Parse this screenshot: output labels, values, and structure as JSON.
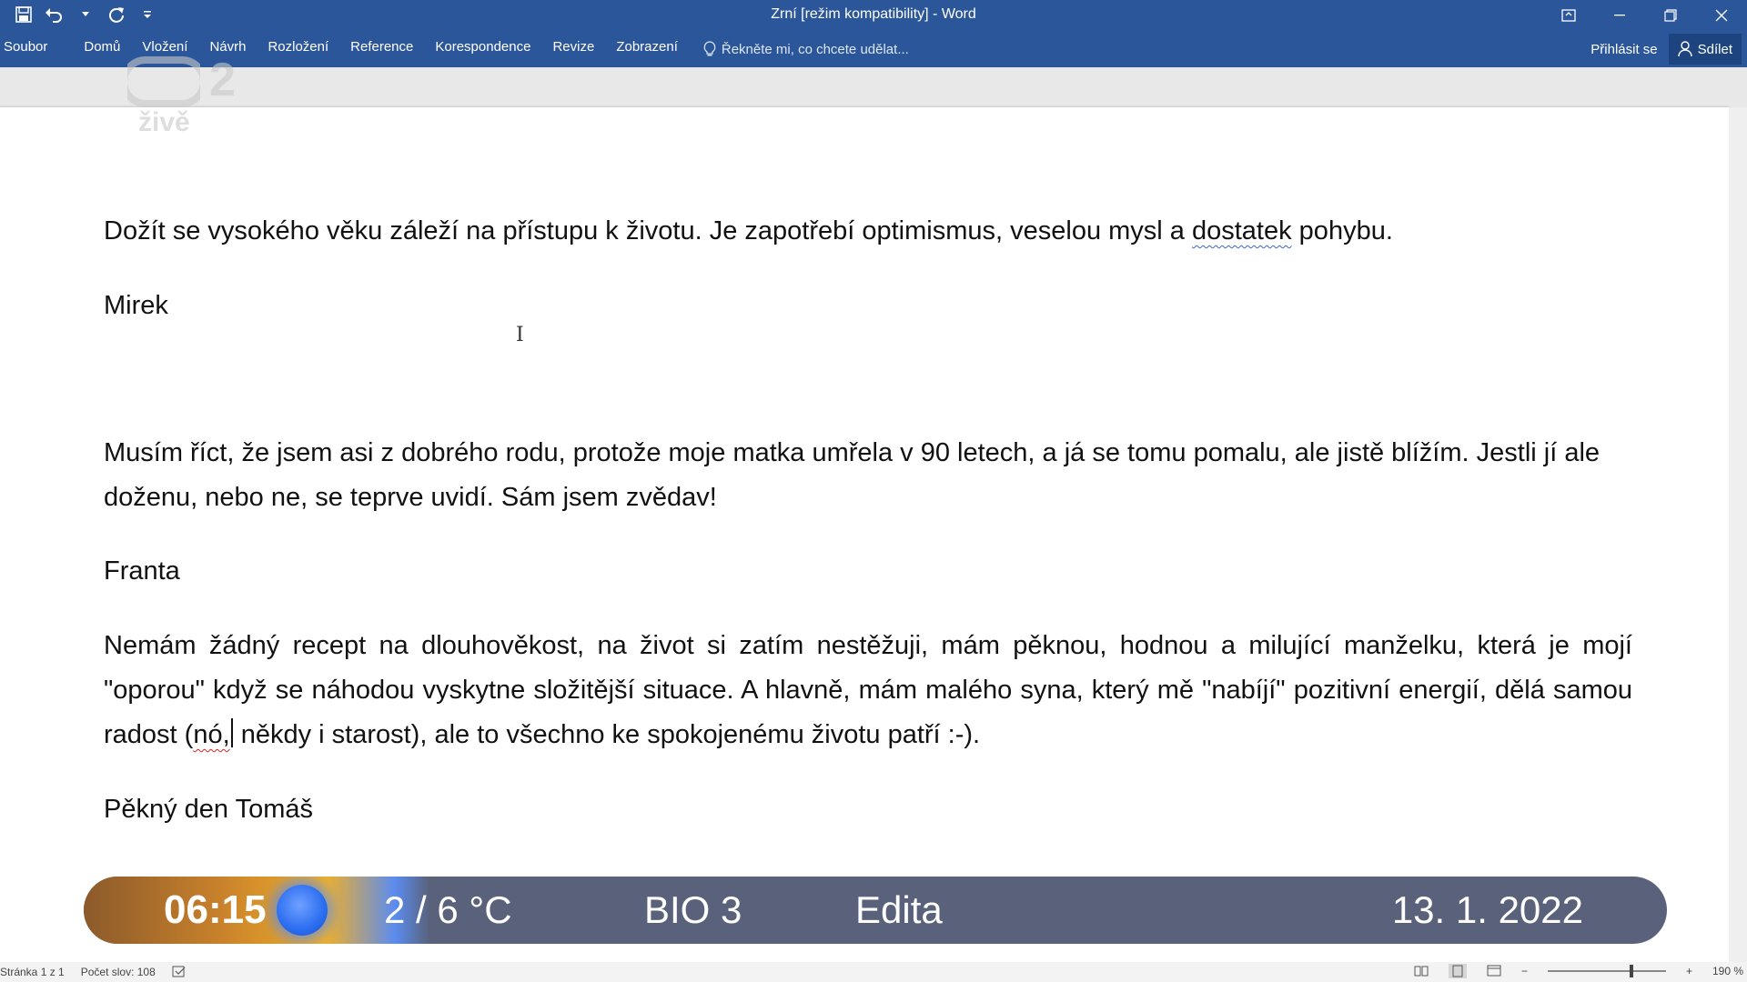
{
  "window": {
    "title": "Zrní [režim kompatibility] - Word"
  },
  "ribbon": {
    "tabs": [
      "Soubor",
      "Domů",
      "Vložení",
      "Návrh",
      "Rozložení",
      "Reference",
      "Korespondence",
      "Revize",
      "Zobrazení"
    ],
    "tell_me": "Řekněte mi, co chcete udělat...",
    "sign_in": "Přihlásit se",
    "share": "Sdílet"
  },
  "watermark": {
    "number": "2",
    "word": "živě"
  },
  "document": {
    "p1_before": "Dožít se vysokého věku záleží na přístupu k životu. Je zapotřebí optimismus, veselou mysl a ",
    "p1_flagged": "dostatek",
    "p1_after": " pohybu.",
    "p2": "Mirek",
    "p3": "Musím říct, že jsem asi z dobrého rodu, protože moje matka umřela v 90 letech, a já se tomu pomalu, ale jistě blížím. Jestli jí ale doženu, nebo ne, se teprve uvidí. Sám jsem zvědav!",
    "p4": "Franta",
    "p5_before": "Nemám žádný recept na dlouhověkost, na život si zatím nestěžuji, mám pěknou, hodnou a milující manželku, která je mojí \"oporou\" když se náhodou vyskytne složitější situace. A hlavně, mám malého syna, který mě \"nabíjí\" pozitivní energií, dělá samou radost (",
    "p5_flagged": "nó,",
    "p5_after": " někdy i starost), ale to všechno ke spokojenému životu patří :-).",
    "p6": "Pěkný den Tomáš"
  },
  "tvbar": {
    "time": "06:15",
    "temperature": "2 / 6 °C",
    "program": "BIO 3",
    "name_day": "Edita",
    "date": "13. 1. 2022"
  },
  "statusbar": {
    "page": "Stránka 1 z 1",
    "words": "Počet slov: 108",
    "zoom": "190 %",
    "zoom_level_percent": 190
  },
  "colors": {
    "word_blue": "#2b579a",
    "spell_red": "#dd2222",
    "grammar_blue": "#3b66c7",
    "tvbar_bg": "#59627a"
  }
}
